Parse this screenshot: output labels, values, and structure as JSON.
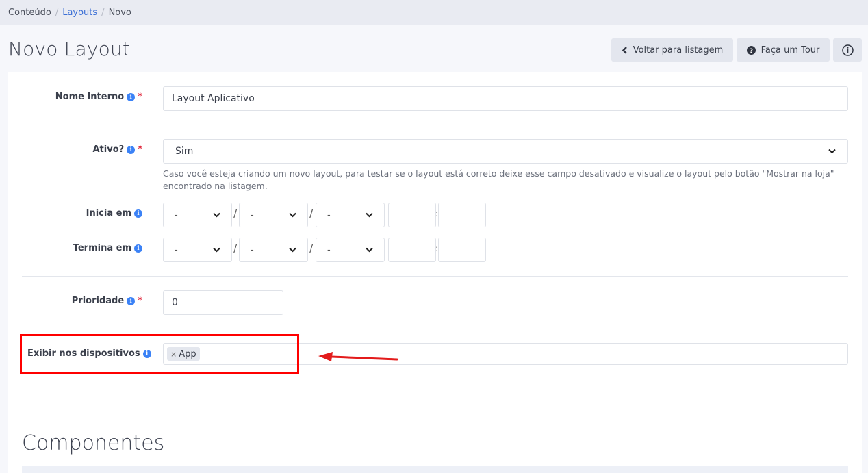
{
  "breadcrumb": {
    "item1": "Conteúdo",
    "item2": "Layouts",
    "item3": "Novo",
    "separator": "/"
  },
  "header": {
    "title": "Novo Layout",
    "back_label": "Voltar para listagem",
    "tour_label": "Faça um Tour"
  },
  "form": {
    "nome_interno": {
      "label": "Nome Interno",
      "required": "*",
      "value": "Layout Aplicativo"
    },
    "ativo": {
      "label": "Ativo?",
      "required": "*",
      "value": "Sim",
      "hint": "Caso você esteja criando um novo layout, para testar se o layout está correto deixe esse campo desativado e visualize o layout pelo botão \"Mostrar na loja\" encontrado na listagem."
    },
    "inicia_em": {
      "label": "Inicia em",
      "day": "-",
      "month": "-",
      "year": "-",
      "date_sep": "/",
      "time_sep": ":"
    },
    "termina_em": {
      "label": "Termina em",
      "day": "-",
      "month": "-",
      "year": "-",
      "date_sep": "/",
      "time_sep": ":"
    },
    "prioridade": {
      "label": "Prioridade",
      "required": "*",
      "value": "0"
    },
    "dispositivos": {
      "label": "Exibir nos dispositivos",
      "tag_remove": "×",
      "tag_value": "App"
    }
  },
  "section": {
    "title": "Componentes"
  },
  "colors": {
    "accent": "#3b82f6",
    "required": "#e0263b",
    "highlight": "#ff0000",
    "link": "#3b6fd6"
  },
  "icons": {
    "back": "chevron-left-icon",
    "tour": "question-circle-icon",
    "info": "info-circle-icon",
    "field_info": "info-icon",
    "select": "chevron-down-icon"
  }
}
